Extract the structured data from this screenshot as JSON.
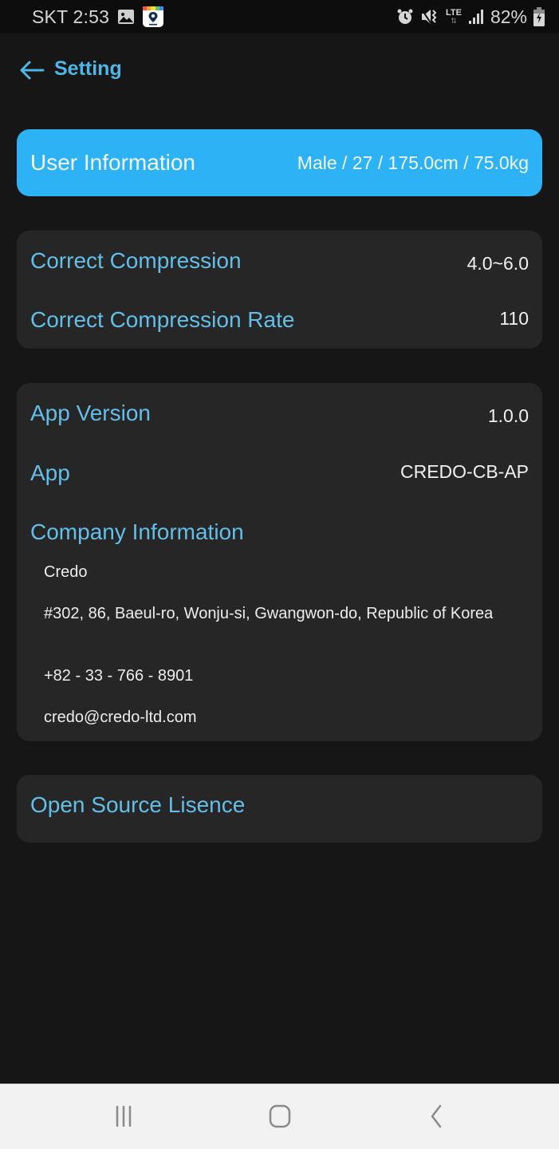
{
  "status_bar": {
    "carrier_time": "SKT 2:53",
    "left_icons": [
      "gallery-icon",
      "map-app-icon"
    ],
    "right_icons": [
      "alarm-icon",
      "vibrate-mute-icon",
      "lte-icon",
      "signal-icon"
    ],
    "lte_label": "LTE",
    "battery_percent": "82%",
    "battery_state": "charging"
  },
  "header": {
    "back_icon": "arrow-left-icon",
    "title": "Setting"
  },
  "user_information": {
    "label": "User Information",
    "value": "Male / 27 / 175.0cm / 75.0kg"
  },
  "compression_section": {
    "rows": [
      {
        "label": "Correct Compression",
        "value": "4.0~6.0"
      },
      {
        "label": "Correct Compression Rate",
        "value": "110"
      }
    ]
  },
  "app_section": {
    "rows": [
      {
        "label": "App Version",
        "value": "1.0.0"
      },
      {
        "label": "App",
        "value": "CREDO-CB-AP"
      }
    ],
    "company": {
      "label": "Company Information",
      "name": "Credo",
      "address": "#302, 86, Baeul-ro, Wonju-si, Gwangwon-do, Republic of Korea",
      "phone": "+82 - 33 - 766 - 8901",
      "email": "credo@credo-ltd.com"
    }
  },
  "open_source": {
    "label": "Open Source Lisence"
  },
  "nav_bar": {
    "buttons": [
      "recent-apps-icon",
      "home-icon",
      "back-icon"
    ]
  },
  "colors": {
    "background": "#161616",
    "card": "#262626",
    "accent": "#2db2f5",
    "label_blue": "#63bfe8",
    "title_blue": "#4fb6e6"
  }
}
